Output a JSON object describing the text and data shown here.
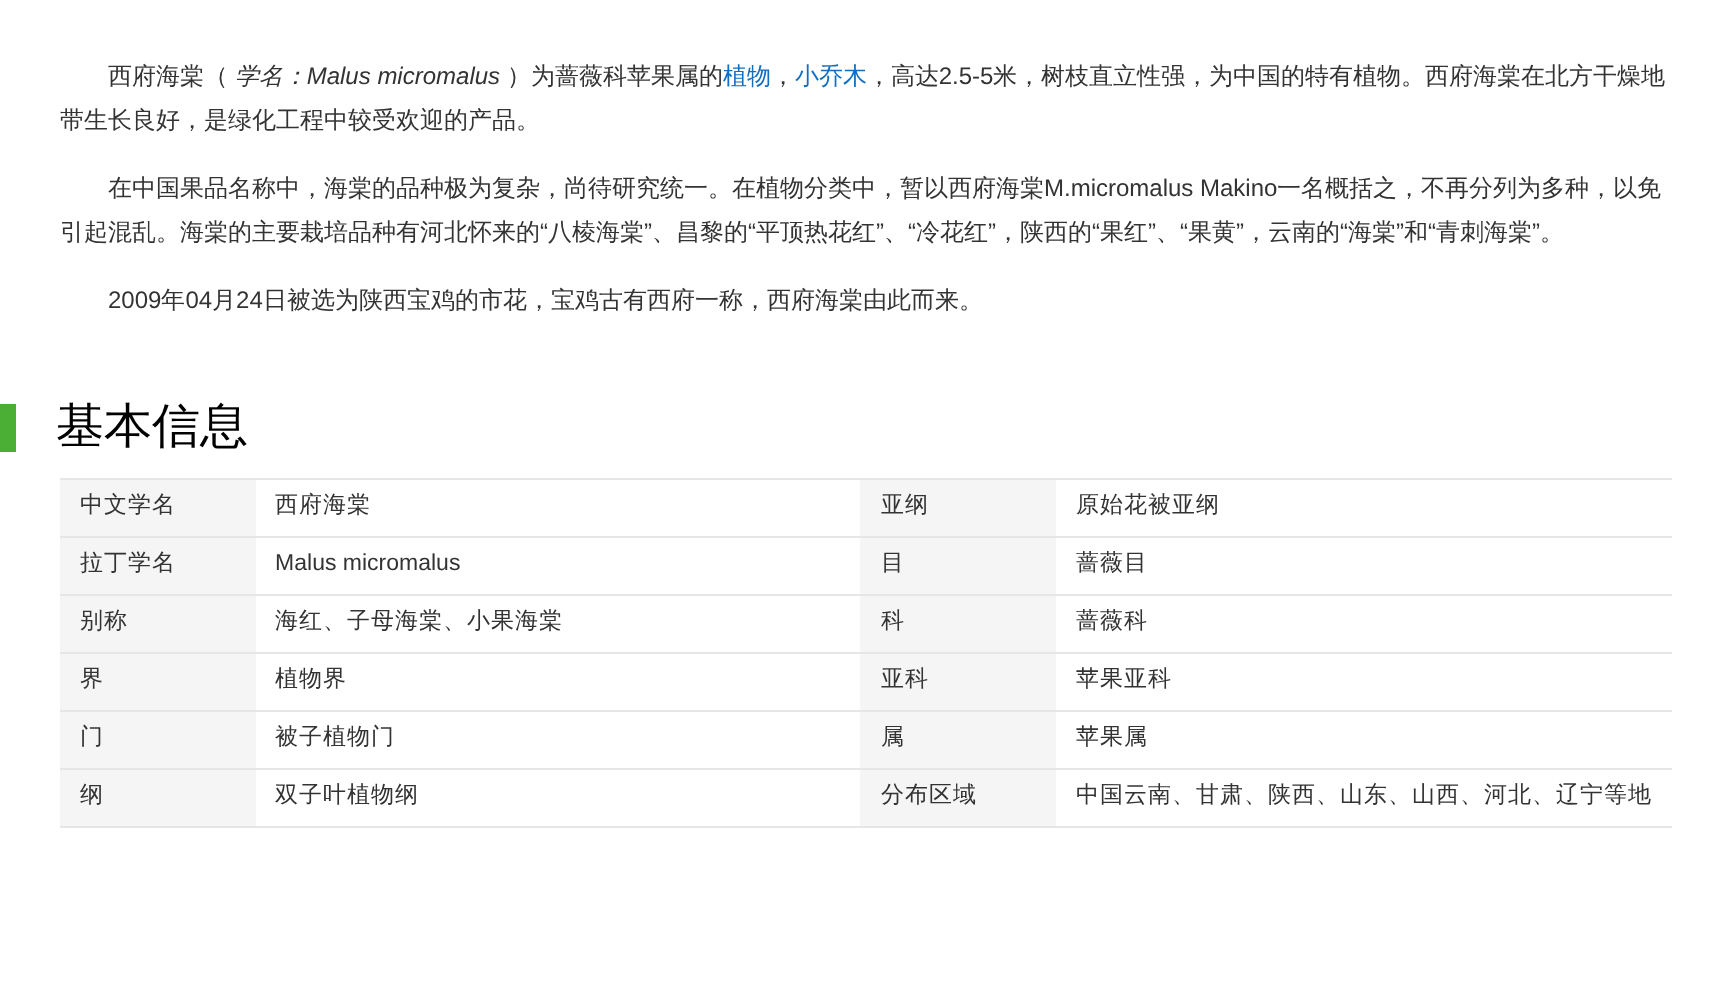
{
  "paragraphs": [
    [
      {
        "kind": "text",
        "text": "西府海棠（ *学名：Malus micromalus* ）为蔷薇科苹果属的"
      },
      {
        "kind": "link",
        "text": "植物"
      },
      {
        "kind": "text",
        "text": "，"
      },
      {
        "kind": "link",
        "text": "小乔木"
      },
      {
        "kind": "text",
        "text": "，高达2.5-5米，树枝直立性强，为中国的特有植物。西府海棠在北方干燥地带生长良好，是绿化工程中较受欢迎的产品。"
      }
    ],
    [
      {
        "kind": "text",
        "text": "在中国果品名称中，海棠的品种极为复杂，尚待研究统一。在植物分类中，暂以西府海棠M.micromalus Makino一名概括之，不再分列为多种，以免引起混乱。海棠的主要栽培品种有河北怀来的“八棱海棠”、昌黎的“平顶热花红”、“冷花红”，陕西的“果红”、“果黄”，云南的“海棠”和“青刺海棠”。"
      }
    ],
    [
      {
        "kind": "text",
        "text": "2009年04月24日被选为陕西宝鸡的市花，宝鸡古有西府一称，西府海棠由此而来。"
      }
    ]
  ],
  "section_title": "基本信息",
  "info_table": {
    "rows": [
      [
        "中文学名",
        "西府海棠",
        "亚纲",
        "原始花被亚纲"
      ],
      [
        "拉丁学名",
        "Malus micromalus",
        "目",
        "蔷薇目"
      ],
      [
        "别称",
        "海红、子母海棠、小果海棠",
        "科",
        "蔷薇科"
      ],
      [
        "界",
        "植物界",
        "亚科",
        "苹果亚科"
      ],
      [
        "门",
        "被子植物门",
        "属",
        "苹果属"
      ],
      [
        "纲",
        "双子叶植物纲",
        "分布区域",
        "中国云南、甘肃、陕西、山东、山西、河北、辽宁等地"
      ]
    ]
  }
}
